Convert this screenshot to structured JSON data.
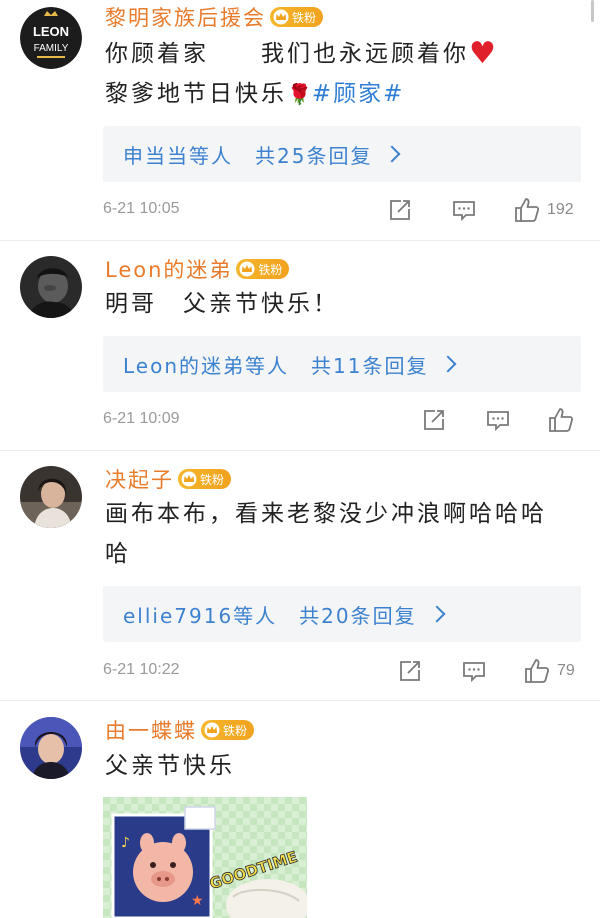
{
  "comments": [
    {
      "username": "黎明家族后援会",
      "badge_label": "铁粉",
      "avatar_text_top": "LEON",
      "avatar_text_bottom": "FAMILY",
      "text_line1_part1": "你顾着家　　我们也永远顾着你",
      "heart": "♥",
      "text_line2_part1": "黎爹地节日快乐",
      "rose": "🌹",
      "hashtag": "#顾家#",
      "reply_summary": "申当当等人　共25条回复",
      "timestamp": "6-21 10:05",
      "like_count": "192"
    },
    {
      "username": "Leon的迷弟",
      "badge_label": "铁粉",
      "text": "明哥　父亲节快乐！",
      "reply_summary": "Leon的迷弟等人　共11条回复",
      "timestamp": "6-21 10:09",
      "like_count": ""
    },
    {
      "username": "决起子",
      "badge_label": "铁粉",
      "text": "画布本布，看来老黎没少冲浪啊哈哈哈哈",
      "reply_summary": "ellie7916等人　共20条回复",
      "timestamp": "6-21 10:22",
      "like_count": "79"
    },
    {
      "username": "由一蝶蝶",
      "badge_label": "铁粉",
      "text": "父亲节快乐",
      "image_caption": "GOODTIME"
    }
  ],
  "colors": {
    "username": "#e87b2c",
    "link": "#3c82cf",
    "badge": "#f5b62a",
    "meta": "#9a9a9a",
    "reply_bg": "#f4f5f7"
  },
  "icons": [
    "share-icon",
    "comment-icon",
    "like-icon",
    "crown-icon",
    "chevron-right-icon"
  ]
}
